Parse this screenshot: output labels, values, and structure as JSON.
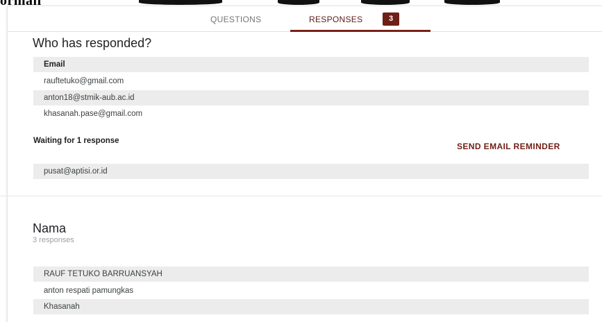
{
  "header_fragment": "ormaii",
  "tabs": {
    "questions_label": "QUESTIONS",
    "responses_label": "RESPONSES",
    "responses_count": "3"
  },
  "responders": {
    "title": "Who has responded?",
    "email_header": "Email",
    "emails": [
      "rauftetuko@gmail.com",
      "anton18@stmik-aub.ac.id",
      "khasanah.pase@gmail.com"
    ],
    "waiting_label": "Waiting for 1 response",
    "reminder_label": "SEND EMAIL REMINDER",
    "pending": [
      "pusat@aptisi.or.id"
    ]
  },
  "question": {
    "title": "Nama",
    "count_label": "3 responses",
    "answers": [
      "RAUF TETUKO BARRUANSYAH",
      "anton respati pamungkas",
      "Khasanah"
    ]
  },
  "colors": {
    "accent": "#6e1f16",
    "row_shade": "#ececec"
  }
}
